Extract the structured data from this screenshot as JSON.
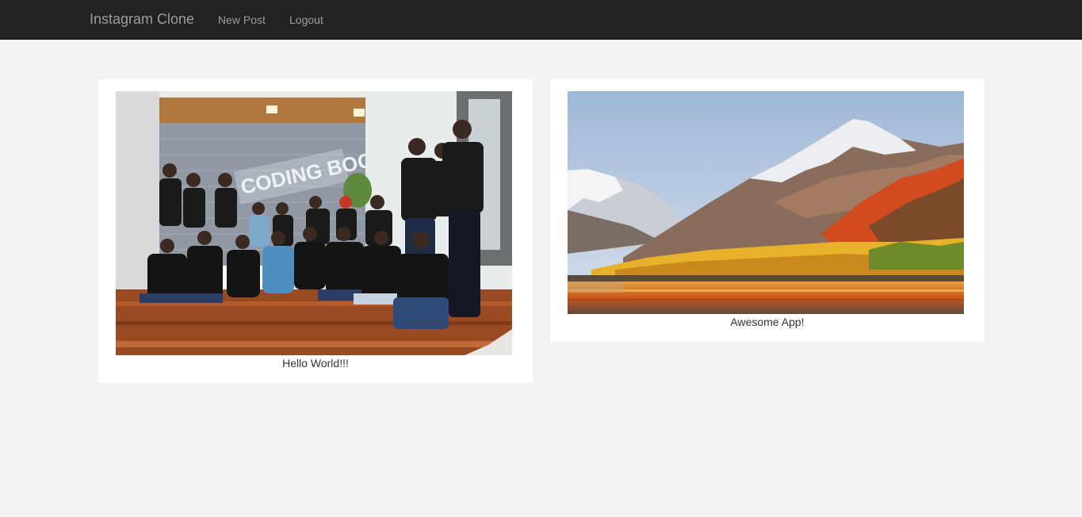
{
  "navbar": {
    "brand": "Instagram Clone",
    "links": [
      {
        "label": "New Post"
      },
      {
        "label": "Logout"
      }
    ]
  },
  "colors": {
    "navbar_bg": "#222222",
    "nav_text": "#9d9d9d",
    "page_bg": "#f2f2f2",
    "card_bg": "#ffffff"
  },
  "posts": [
    {
      "image_description": "group-photo",
      "image_text": "CODING BOOTCAMP",
      "caption": "Hello World!!!"
    },
    {
      "image_description": "mountain-landscape",
      "caption": "Awesome App!"
    }
  ]
}
